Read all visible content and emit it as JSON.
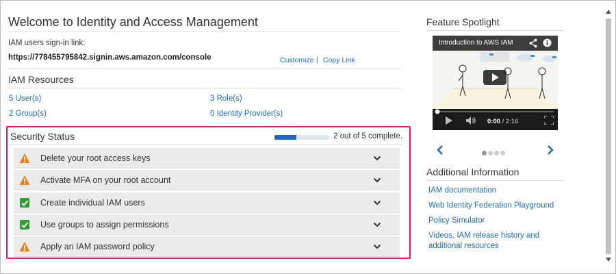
{
  "welcome": {
    "title": "Welcome to Identity and Access Management",
    "signin_label": "IAM users sign-in link:",
    "signin_url": "https://778455795842.signin.aws.amazon.com/console",
    "customize": "Customize",
    "separator": "|",
    "copy_link": "Copy Link"
  },
  "resources": {
    "title": "IAM Resources",
    "users": "5 User(s)",
    "roles": "3 Role(s)",
    "groups": "2 Group(s)",
    "identity_providers": "0 Identity Provider(s)"
  },
  "security": {
    "title": "Security Status",
    "progress_text": "2 out of 5 complete.",
    "progress_fraction": 0.4,
    "items": [
      {
        "label": "Delete your root access keys",
        "status": "warning"
      },
      {
        "label": "Activate MFA on your root account",
        "status": "warning"
      },
      {
        "label": "Create individual IAM users",
        "status": "complete"
      },
      {
        "label": "Use groups to assign permissions",
        "status": "complete"
      },
      {
        "label": "Apply an IAM password policy",
        "status": "warning"
      }
    ]
  },
  "spotlight": {
    "title": "Feature Spotlight",
    "video_title": "Introduction to AWS IAM",
    "current_time": "0:00",
    "duration": "/ 2:16",
    "dots_total": 4,
    "dots_active": 0
  },
  "additional": {
    "title": "Additional Information",
    "links": [
      "IAM documentation",
      "Web Identity Federation Playground",
      "Policy Simulator",
      "Videos, IAM release history and additional resources"
    ]
  },
  "colors": {
    "link": "#1f6bb3",
    "warning": "#e8811a",
    "complete": "#2e9e35",
    "highlight_border": "#e8175d"
  }
}
